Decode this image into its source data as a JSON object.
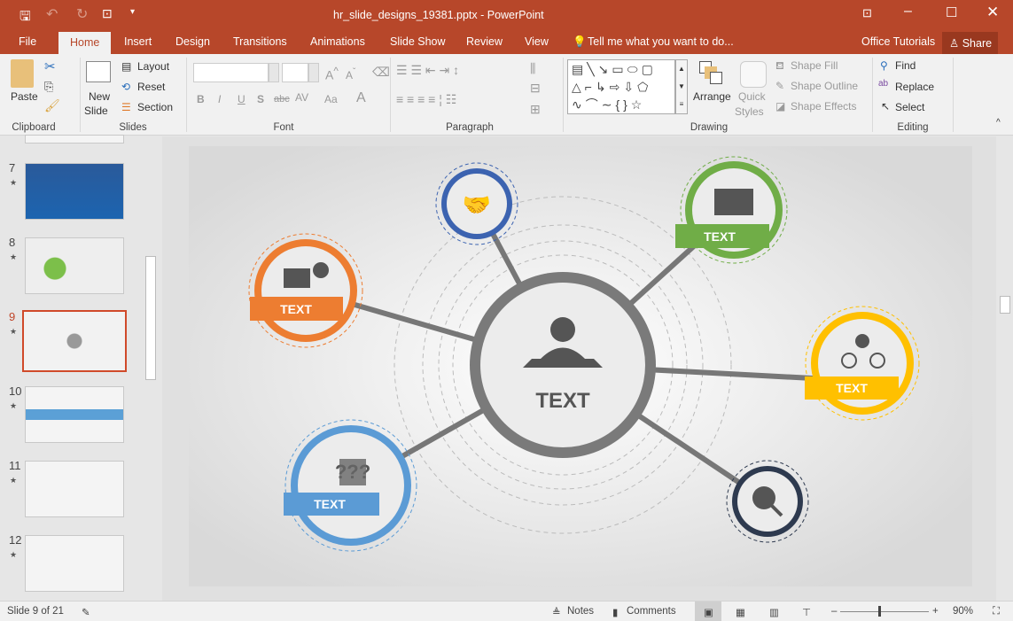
{
  "window": {
    "title": "hr_slide_designs_19381.pptx - PowerPoint"
  },
  "tabs": [
    "File",
    "Home",
    "Insert",
    "Design",
    "Transitions",
    "Animations",
    "Slide Show",
    "Review",
    "View"
  ],
  "tell_me": "Tell me what you want to do...",
  "account": "Office Tutorials",
  "share": "Share",
  "ribbon": {
    "clipboard": {
      "paste": "Paste",
      "label": "Clipboard"
    },
    "slides": {
      "new_slide_1": "New",
      "new_slide_2": "Slide",
      "layout": "Layout",
      "reset": "Reset",
      "section": "Section",
      "label": "Slides"
    },
    "font": {
      "label": "Font",
      "bold": "B",
      "italic": "I",
      "underline": "U",
      "shadow": "S",
      "strike": "abc",
      "spacing": "AV",
      "case": "Aa",
      "color": "A"
    },
    "paragraph": {
      "label": "Paragraph"
    },
    "drawing": {
      "arrange": "Arrange",
      "quick1": "Quick",
      "quick2": "Styles",
      "fill": "Shape Fill",
      "outline": "Shape Outline",
      "effects": "Shape Effects",
      "label": "Drawing"
    },
    "editing": {
      "find": "Find",
      "replace": "Replace",
      "select": "Select",
      "label": "Editing"
    }
  },
  "thumbnails": [
    {
      "num": "7"
    },
    {
      "num": "8"
    },
    {
      "num": "9",
      "selected": true
    },
    {
      "num": "10"
    },
    {
      "num": "11"
    },
    {
      "num": "12"
    }
  ],
  "slide": {
    "center_label": "TEXT",
    "labels": [
      "TEXT",
      "TEXT",
      "TEXT",
      "TEXT"
    ],
    "colors": {
      "orange": "#ed7d31",
      "green": "#70ad47",
      "yellow": "#ffc000",
      "blue": "#5b9bd5",
      "navy": "#2e3a4f",
      "darkblue": "#3c63b0",
      "gray": "#7a7a7a"
    }
  },
  "status": {
    "slide": "Slide 9 of 21",
    "notes": "Notes",
    "comments": "Comments",
    "zoom": "90%",
    "zoom_fraction": 0.45
  }
}
